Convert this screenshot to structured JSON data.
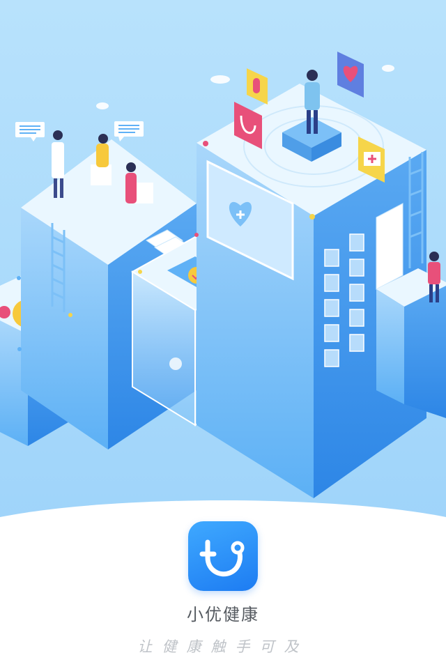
{
  "app": {
    "name": "小优健康",
    "slogan": "让健康触手可及"
  },
  "colors": {
    "sky": "#a6d9fb",
    "block_light": "#e8f6ff",
    "block_mid": "#5fb1f6",
    "block_dark": "#2f8ae8",
    "logo_blue": "#1d7cf2",
    "heart_red": "#e8507a",
    "card_yellow": "#f6d54a"
  },
  "icons": [
    "heart-cross-icon",
    "pill-icon",
    "stethoscope-icon",
    "first-aid-icon",
    "gear-icon",
    "chat-bubble-icon",
    "cloud-icon",
    "shield-check-icon"
  ]
}
